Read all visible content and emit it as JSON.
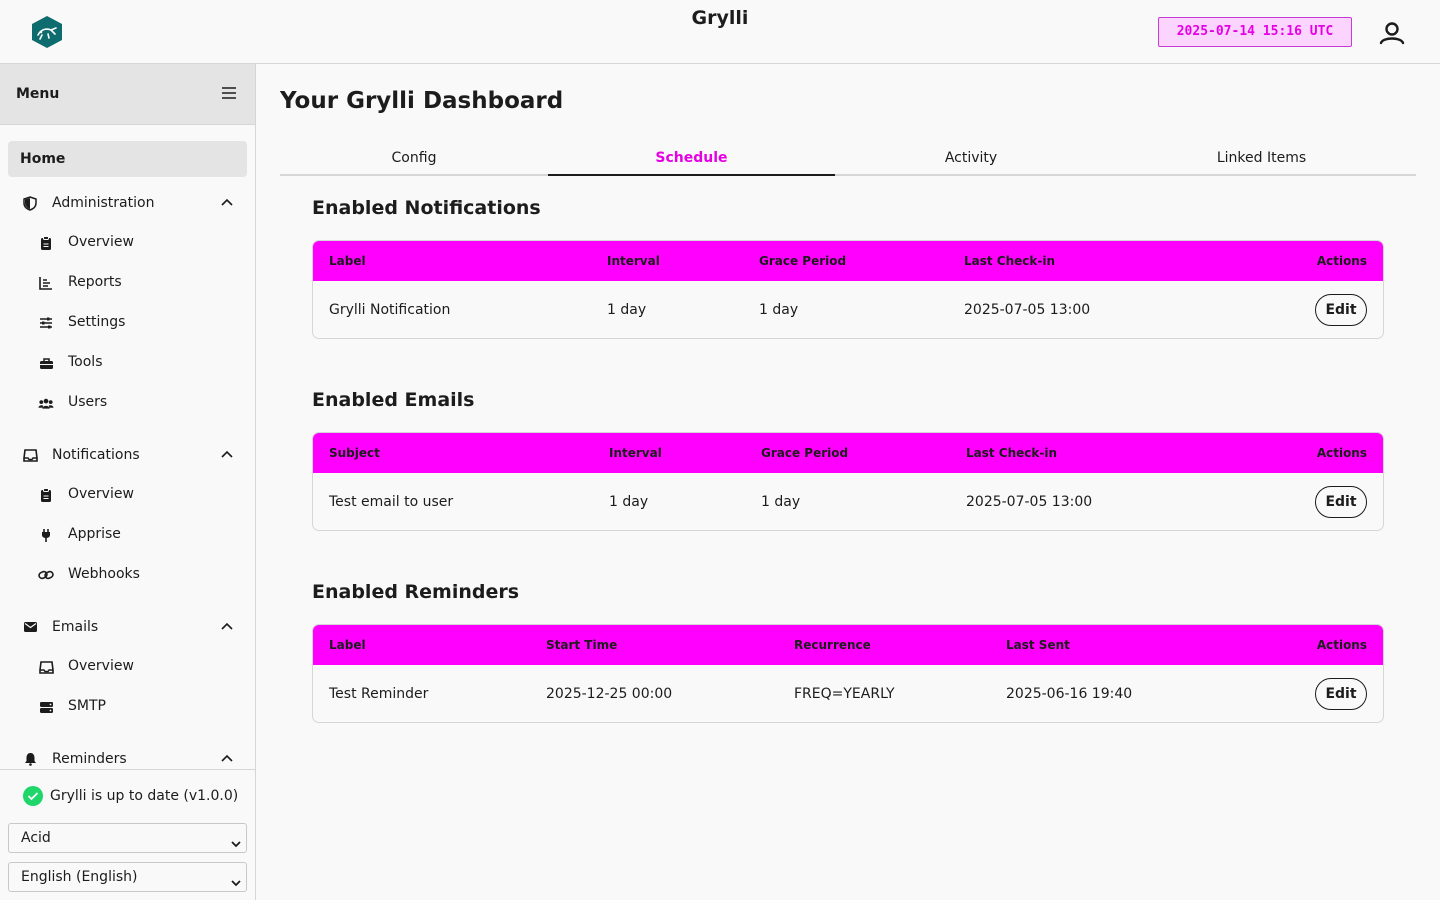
{
  "app": {
    "title": "Grylli",
    "clock": "2025-07-14 15:16 UTC"
  },
  "sidebar": {
    "menu_title": "Menu",
    "home": "Home",
    "sections": [
      {
        "label": "Administration",
        "icon": "shield-icon",
        "items": [
          {
            "label": "Overview",
            "icon": "clipboard-icon"
          },
          {
            "label": "Reports",
            "icon": "chart-icon"
          },
          {
            "label": "Settings",
            "icon": "sliders-icon"
          },
          {
            "label": "Tools",
            "icon": "toolbox-icon"
          },
          {
            "label": "Users",
            "icon": "users-icon"
          }
        ]
      },
      {
        "label": "Notifications",
        "icon": "inbox-icon",
        "items": [
          {
            "label": "Overview",
            "icon": "clipboard-icon"
          },
          {
            "label": "Apprise",
            "icon": "plug-icon"
          },
          {
            "label": "Webhooks",
            "icon": "link-icon"
          }
        ]
      },
      {
        "label": "Emails",
        "icon": "envelope-icon",
        "items": [
          {
            "label": "Overview",
            "icon": "inbox-icon"
          },
          {
            "label": "SMTP",
            "icon": "server-icon"
          }
        ]
      },
      {
        "label": "Reminders",
        "icon": "bell-icon",
        "items": []
      }
    ],
    "status": "Grylli is up to date (v1.0.0)",
    "theme_select": "Acid",
    "language_select": "English (English)"
  },
  "main": {
    "title": "Your Grylli Dashboard",
    "tabs": [
      {
        "label": "Config",
        "active": false
      },
      {
        "label": "Schedule",
        "active": true
      },
      {
        "label": "Activity",
        "active": false
      },
      {
        "label": "Linked Items",
        "active": false
      }
    ],
    "notifications": {
      "title": "Enabled Notifications",
      "headers": [
        "Label",
        "Interval",
        "Grace Period",
        "Last Check-in",
        "Actions"
      ],
      "rows": [
        {
          "cells": [
            "Grylli Notification",
            "1 day",
            "1 day",
            "2025-07-05 13:00"
          ],
          "action": "Edit"
        }
      ]
    },
    "emails": {
      "title": "Enabled Emails",
      "headers": [
        "Subject",
        "Interval",
        "Grace Period",
        "Last Check-in",
        "Actions"
      ],
      "rows": [
        {
          "cells": [
            "Test email to user",
            "1 day",
            "1 day",
            "2025-07-05 13:00"
          ],
          "action": "Edit"
        }
      ]
    },
    "reminders": {
      "title": "Enabled Reminders",
      "headers": [
        "Label",
        "Start Time",
        "Recurrence",
        "Last Sent",
        "Actions"
      ],
      "rows": [
        {
          "cells": [
            "Test Reminder",
            "2025-12-25 00:00",
            "FREQ=YEARLY",
            "2025-06-16 19:40"
          ],
          "action": "Edit"
        }
      ]
    }
  },
  "colors": {
    "accent": "#ff00ff",
    "accent_text": "#e600e6",
    "clock_bg": "#fbd4ff",
    "status_ok": "#1fd66b"
  }
}
